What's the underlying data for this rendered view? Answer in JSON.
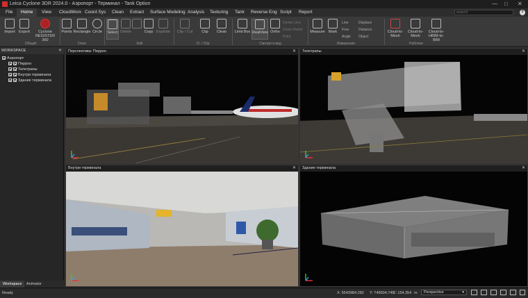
{
  "window": {
    "title": "Leica Cyclone 3DR 2024.0 - Аэропорт - Терминал - Tank Option",
    "minimize": "—",
    "maximize": "□",
    "close": "✕"
  },
  "menu": {
    "tabs": [
      "File",
      "Home",
      "View",
      "CloudWorx",
      "Coord Sys",
      "Clean",
      "Extract",
      "Surface Modeling",
      "Analysis",
      "Texturing",
      "Tank",
      "Reverse Eng",
      "Script",
      "Report"
    ],
    "active": "Home",
    "search_placeholder": "search"
  },
  "ribbon": {
    "import": "Import",
    "export": "Export",
    "cyclone_register": "Cyclone REGISTER 360",
    "group_general": "Общий",
    "points": "Points",
    "rectangle": "Rectangle",
    "circle": "Circle",
    "group_draw": "Draw",
    "select": "Select",
    "delete": "Delete",
    "copy": "Copy",
    "explode": "Explode",
    "group_edit": "Edit",
    "clip_cut": "Clip / Cut",
    "clip": "Clip",
    "clean": "Clean",
    "group_clip": "Cl. / Clip",
    "limit_box": "Limit Box",
    "realview": "RealView",
    "ortho": "Ortho",
    "center_line": "Center Line",
    "cross_points": "Cross Points",
    "point_label": "Point",
    "group_view": "Смотри и вид",
    "measure": "Measure",
    "mark": "Mark",
    "line": "Line",
    "free": "Free",
    "angle": "Angle",
    "distance_e": "Distance",
    "displace": "Displace",
    "object": "Object",
    "group_measure": "Измерения",
    "cloud_to_mesh": "Cloud-to-Mesh",
    "cloud_to_mesh2": "Cloud-to-Mesh",
    "cloud_to_hbim": "Cloud-to-HBIM-to-BIM",
    "group_workflow": "Рабочие"
  },
  "workspace": {
    "title": "WORKSPACE",
    "root": "Аэропорт",
    "items": [
      "Перрон",
      "Телетрапы",
      "Внутри терминала",
      "Здание терминала"
    ]
  },
  "bottom_tabs": [
    "Workspace",
    "Animator"
  ],
  "viewports": {
    "tl": "Перспектива: Перрон",
    "tr": "Телетрапы",
    "bl": "Внутри терминала",
    "br": "Здание терминала",
    "close": "✕"
  },
  "status": {
    "ready": "Ready",
    "x": "X: 5543984.282",
    "y": "Y: 749504.745",
    "z": "Z: 154.354",
    "unit": "m",
    "projection": "Perspective"
  }
}
